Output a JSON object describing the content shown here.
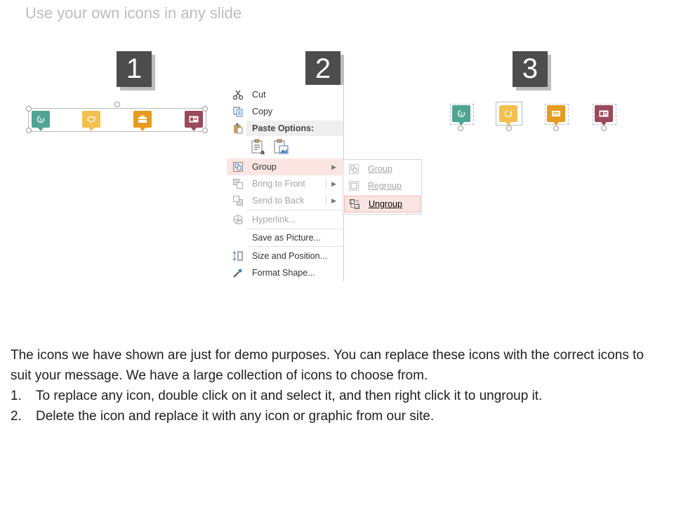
{
  "title": "Use your own icons in any slide",
  "steps": [
    "1",
    "2",
    "3"
  ],
  "context_menu": {
    "items": [
      {
        "label": "Cut",
        "icon": "scissors-icon",
        "disabled": false
      },
      {
        "label": "Copy",
        "icon": "copy-icon",
        "disabled": false
      },
      {
        "label": "Paste Options:",
        "icon": "paste-icon",
        "header": true
      },
      {
        "label": "Group",
        "icon": "group-icon",
        "disabled": false,
        "submenu": true,
        "highlighted": true
      },
      {
        "label": "Bring to Front",
        "icon": "bring-to-front-icon",
        "disabled": true,
        "submenu": true
      },
      {
        "label": "Send to Back",
        "icon": "send-to-back-icon",
        "disabled": true,
        "submenu": true
      },
      {
        "label": "Hyperlink...",
        "icon": "hyperlink-icon",
        "disabled": true
      },
      {
        "label": "Save as Picture...",
        "icon": "",
        "disabled": false
      },
      {
        "label": "Size and Position...",
        "icon": "size-position-icon",
        "disabled": false
      },
      {
        "label": "Format Shape...",
        "icon": "format-shape-icon",
        "disabled": false
      }
    ]
  },
  "submenu": {
    "items": [
      {
        "label": "Group",
        "icon": "group-icon",
        "disabled": true
      },
      {
        "label": "Regroup",
        "icon": "regroup-icon",
        "disabled": true
      },
      {
        "label": "Ungroup",
        "icon": "ungroup-icon",
        "disabled": false,
        "highlighted": true
      }
    ]
  },
  "icon_colors": {
    "teal": "#4fa492",
    "yellow": "#f3c04f",
    "orange": "#e79b1f",
    "maroon": "#9b4a5b"
  },
  "body": {
    "intro": "The icons we have shown are just for demo purposes. You can replace these icons with the correct icons to suit your message. We have a large collection of icons to choose from.",
    "list": [
      {
        "num": "1.",
        "text": "To replace any icon, double click on it and select it, and then right click it to ungroup it."
      },
      {
        "num": "2.",
        "text": "Delete the icon and replace it with any icon or graphic from our site."
      }
    ]
  }
}
